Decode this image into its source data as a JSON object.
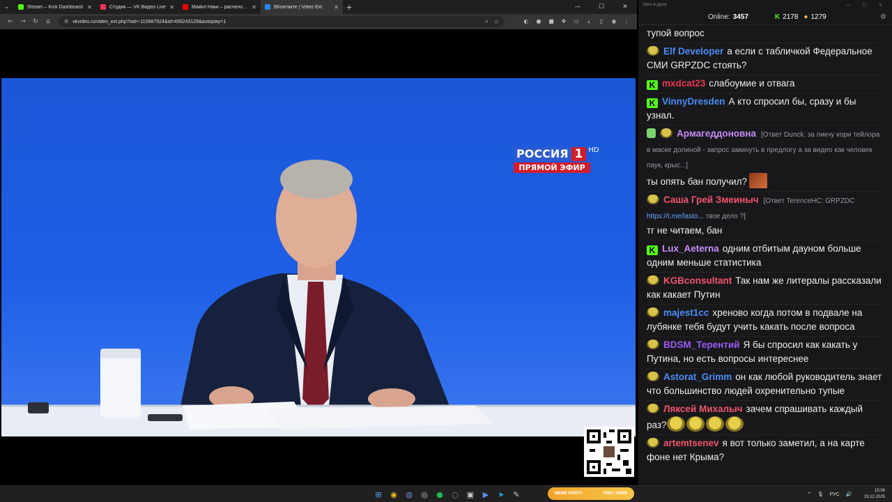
{
  "browser": {
    "tabs": [
      {
        "title": "Stream – Kick Dashboard",
        "color": "#53fc18"
      },
      {
        "title": "Студия — VK Видео Live",
        "color": "#ff3355"
      },
      {
        "title": "Майкл Наки – расчеловечив...",
        "color": "#ff0000"
      },
      {
        "title": "ВКонтакте | Video Ext",
        "color": "#2787f5"
      }
    ],
    "url": "vkvideo.ru/video_ext.php?oid=-115987924&id=456243129&autoplay=1"
  },
  "video": {
    "channel_name": "РОССИЯ",
    "channel_number": "1",
    "hd_label": "HD",
    "live_label": "ПРЯМОЙ ЭФИР"
  },
  "chat": {
    "window_title": "Окно в душу",
    "online_label": "Online:",
    "online_count": "3457",
    "kick_count": "2178",
    "vk_count": "1279",
    "messages": [
      {
        "badges": [],
        "user": "",
        "color": "#efeff1",
        "reply": "",
        "text": "тупой вопрос"
      },
      {
        "badges": [
          "pepe"
        ],
        "user": "Elf Developer",
        "color": "#4b8df5",
        "reply": "",
        "text": "а если с табличкой Федеральное СМИ GRPZDC стоять?"
      },
      {
        "badges": [
          "kick"
        ],
        "user": "mxdcat23",
        "color": "#e8384f",
        "reply": "",
        "text": "слабоумие и отвага"
      },
      {
        "badges": [
          "kick"
        ],
        "user": "VinnyDresden",
        "color": "#4b8df5",
        "reply": "",
        "text": "А кто спросил бы, сразу и бы узнал."
      },
      {
        "badges": [
          "shield",
          "pepe"
        ],
        "user": "Армагеддоновна",
        "color": "#c78df5",
        "reply": "[Ответ Dunck: за пикчу кори тейлора в маске долиной - запрос закинуть в предлогу а за видео как человек паук, крыс...]",
        "text": "ты опять бан получил?",
        "emote": "face"
      },
      {
        "badges": [
          "pepe"
        ],
        "user": "Саша Грей Змеиныч",
        "color": "#f2556b",
        "reply": "[Ответ TerenceHC: GRPZDC",
        "reply_link": "https://t.me/lasto...",
        "reply_tail": "твое дело ?]",
        "text": "тг не читаем, бан"
      },
      {
        "badges": [
          "kick"
        ],
        "user": "Lux_Aeterna",
        "color": "#c78df5",
        "reply": "",
        "text": "одним отбитым дауном больше одним меньше статистика"
      },
      {
        "badges": [
          "pepe"
        ],
        "user": "KGBconsultant",
        "color": "#f2556b",
        "reply": "",
        "text": "Так нам же литералы рассказали как какает Путин"
      },
      {
        "badges": [
          "pepe"
        ],
        "user": "majest1cc",
        "color": "#4b8df5",
        "reply": "",
        "text": "хреново когда потом в подвале на лубянке тебя будут учить какать после вопроса"
      },
      {
        "badges": [
          "pepe"
        ],
        "user": "BDSM_Терентий",
        "color": "#9b5cf6",
        "reply": "",
        "text": "Я бы спросил как какать у Путина, но есть вопросы интереснее"
      },
      {
        "badges": [
          "pepe"
        ],
        "user": "Astorat_Grimm",
        "color": "#4b8df5",
        "reply": "",
        "text": "он как любой руководитель знает что большинство людей охренительно тупые"
      },
      {
        "badges": [
          "pepe"
        ],
        "user": "Ляксей Михалыч",
        "color": "#f2556b",
        "reply": "",
        "text": "зачем спрашивать каждый раз?",
        "emotes_after": 4
      },
      {
        "badges": [
          "pepe"
        ],
        "user": "artemtsenev",
        "color": "#f2556b",
        "reply": "",
        "text": "я вот только заметил, а на карте фоне нет Крыма?"
      }
    ]
  },
  "taskbar": {
    "meme_label": "MEME PARTY",
    "meme_progress": "7400 / 15000",
    "lang": "РУС",
    "time": "15:06",
    "date": "19.12.2025"
  }
}
